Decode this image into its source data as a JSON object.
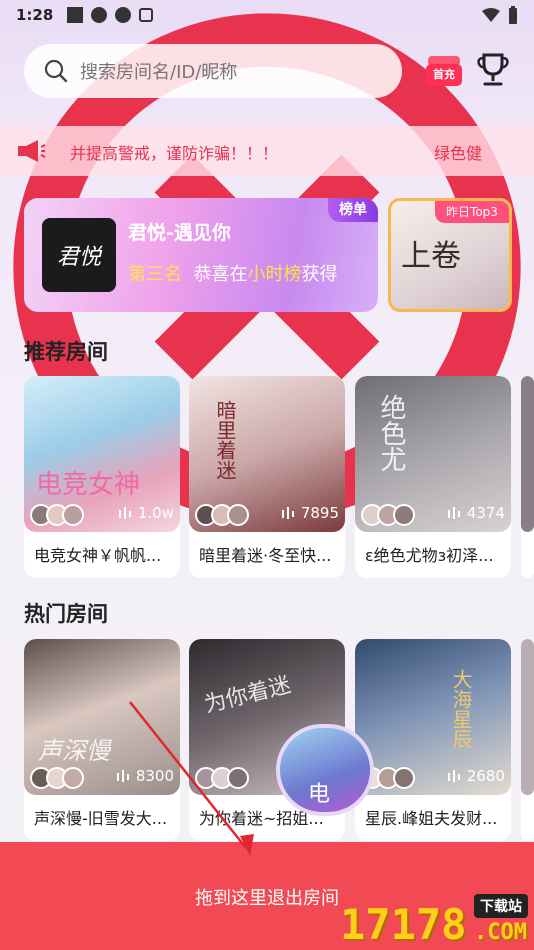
{
  "status_bar": {
    "time": "1:28"
  },
  "search": {
    "placeholder": "搜索房间名/ID/昵称"
  },
  "header": {
    "first_charge_label": "首充"
  },
  "notice": {
    "text": "并提高警戒，谨防诈骗！！！",
    "text_tail": "绿色健"
  },
  "banner": {
    "badge": "榜单",
    "avatar_text": "君悦",
    "room_name": "君悦-遇见你",
    "rank_label": "第三名",
    "congrats_text": "恭喜在",
    "board_name": "小时榜",
    "suffix_text": "获得"
  },
  "top3": {
    "tag": "昨日Top3",
    "art_text": "上卷"
  },
  "recommended": {
    "title": "推荐房间",
    "rooms": [
      {
        "name": "电竞女神￥帆帆...",
        "count": "1.0w",
        "art": "电竞女神"
      },
      {
        "name": "暗里着迷·冬至快...",
        "count": "7895",
        "art": "暗里着迷"
      },
      {
        "name": "ε绝色尤物з初泽...",
        "count": "4374",
        "art": "绝色尤"
      }
    ]
  },
  "hot": {
    "title": "热门房间",
    "rooms": [
      {
        "name": "声深慢-旧雪发大...",
        "count": "8300",
        "art": "声深慢"
      },
      {
        "name": "为你着迷~招姐...",
        "count": "",
        "art": "为你着迷"
      },
      {
        "name": "星辰.峰姐夫发财...",
        "count": "2680",
        "art": "大海星辰"
      }
    ]
  },
  "floating_room": {
    "label": "电"
  },
  "exit_bar": {
    "text": "拖到这里退出房间"
  },
  "watermark": {
    "number": "17178",
    "download": "下载站",
    "domain": ".COM"
  }
}
